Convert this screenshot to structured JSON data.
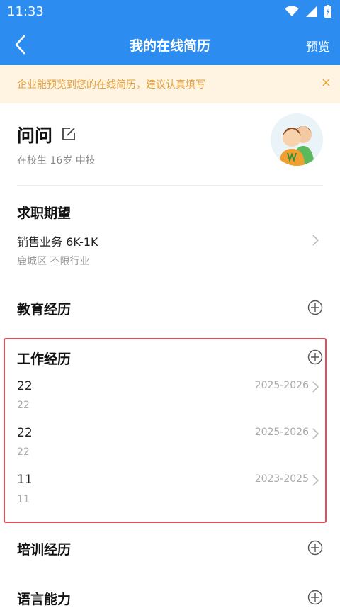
{
  "status_bar": {
    "time": "11:33"
  },
  "nav": {
    "title": "我的在线简历",
    "preview_label": "预览"
  },
  "notice": {
    "text": "企业能预览到您的在线简历，建议认真填写",
    "close": "×"
  },
  "profile": {
    "name": "问问",
    "meta": "在校生 16岁 中技"
  },
  "job_intention": {
    "title": "求职期望",
    "position": "销售业务 6K-1K",
    "details": "鹿城区 不限行业"
  },
  "education": {
    "title": "教育经历"
  },
  "work": {
    "title": "工作经历",
    "entries": [
      {
        "company": "22",
        "position": "22",
        "period": "2025-2026"
      },
      {
        "company": "22",
        "position": "22",
        "period": "2025-2026"
      },
      {
        "company": "11",
        "position": "11",
        "period": "2023-2025"
      }
    ]
  },
  "training": {
    "title": "培训经历"
  },
  "language": {
    "title": "语言能力"
  },
  "colors": {
    "primary": "#2d8cf0",
    "notice_bg": "#fff4e2",
    "notice_text": "#e6a23c",
    "highlight": "#e0505a"
  }
}
